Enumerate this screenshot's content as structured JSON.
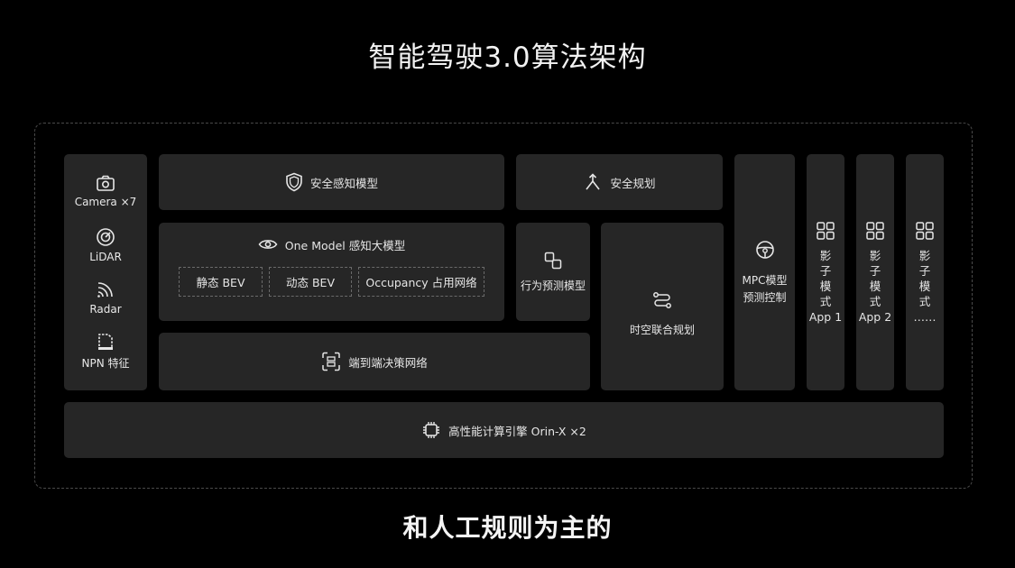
{
  "title": "智能驾驶3.0算法架构",
  "subtitle": "和人工规则为主的",
  "sensors": [
    {
      "label": "Camera ×7",
      "icon": "camera-icon"
    },
    {
      "label": "LiDAR",
      "icon": "lidar-icon"
    },
    {
      "label": "Radar",
      "icon": "radar-icon"
    },
    {
      "label": "NPN 特征",
      "icon": "npn-icon"
    }
  ],
  "modules": {
    "safety_perception": "安全感知模型",
    "safety_planning": "安全规划",
    "one_model": "One Model 感知大模型",
    "bev_static": "静态 BEV",
    "bev_dynamic": "动态 BEV",
    "occupancy": "Occupancy 占用网络",
    "behavior_prediction": "行为预测模型",
    "spatiotemporal_planning": "时空联合规划",
    "end_to_end": "端到端决策网络",
    "mpc_line1": "MPC模型",
    "mpc_line2": "预测控制",
    "compute_engine": "高性能计算引擎 Orin-X ×2"
  },
  "shadow_modes": [
    {
      "chars": [
        "影",
        "子",
        "模",
        "式"
      ],
      "app": "App 1"
    },
    {
      "chars": [
        "影",
        "子",
        "模",
        "式"
      ],
      "app": "App 2"
    },
    {
      "chars": [
        "影",
        "子",
        "模",
        "式"
      ],
      "app": "……"
    }
  ]
}
